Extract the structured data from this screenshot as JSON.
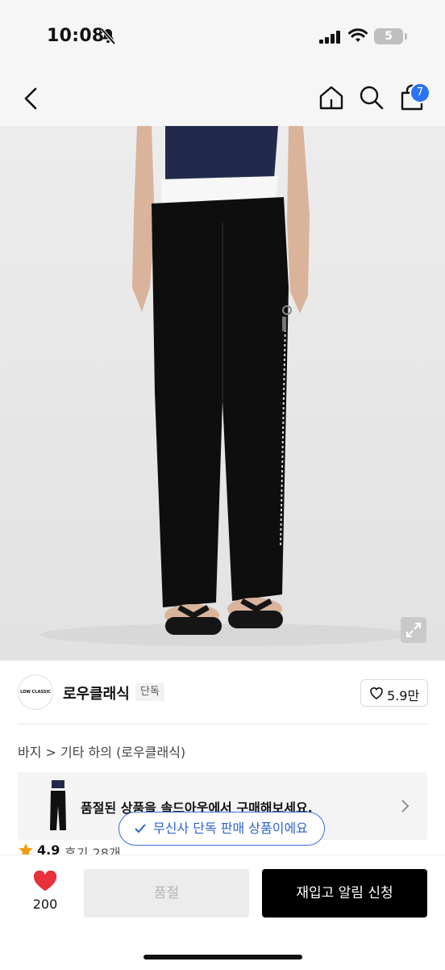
{
  "status": {
    "time": "10:08",
    "battery": "5"
  },
  "nav": {
    "cart_count": "7"
  },
  "brand": {
    "logo_text": "LOW CLASSIC",
    "name": "로우클래식",
    "tag": "단독",
    "likes": "5.9만"
  },
  "breadcrumb": {
    "text": "바지 > 기타 하의 (로우클래식)"
  },
  "soldout_banner": {
    "text": "품절된 상품을 솔드아웃에서 구매해보세요."
  },
  "exclusive_notice": "무신사 단독 판매 상품이에요",
  "rating": {
    "score": "4.9",
    "reviews": "후기 28개"
  },
  "bottom": {
    "wish_count": "200",
    "soldout_label": "품절",
    "restock_label": "재입고 알림 신청"
  },
  "colors": {
    "accent_blue": "#2b73f0",
    "heart_red": "#e8313c",
    "star_orange": "#f39c12"
  },
  "icons": [
    "bell-slash-icon",
    "signal-icon",
    "wifi-icon",
    "battery-icon",
    "back-chevron-icon",
    "home-icon",
    "search-icon",
    "cart-icon",
    "expand-icon",
    "heart-outline-icon",
    "chevron-right-icon",
    "check-icon",
    "star-icon",
    "heart-filled-icon"
  ]
}
